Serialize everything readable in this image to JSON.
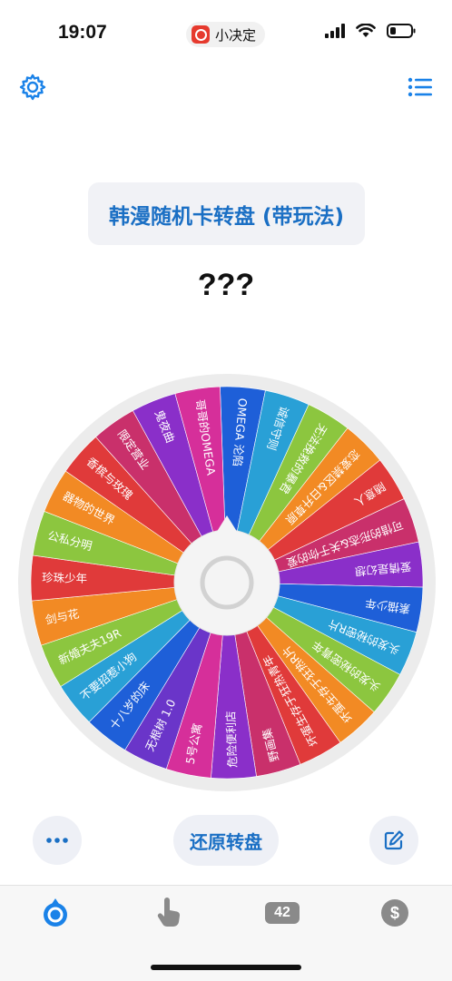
{
  "status": {
    "time": "19:07",
    "app_name": "小决定"
  },
  "header": {
    "settings_icon": "gear-icon",
    "list_icon": "list-icon"
  },
  "wheel": {
    "title": "韩漫随机卡转盘 (带玩法)",
    "result": "???",
    "items": [
      {
        "label": "OMEGA 沦陷",
        "color": "#1e5fd8"
      },
      {
        "label": "诚信守则",
        "color": "#29a0d6"
      },
      {
        "label": "无法挽救的暴君",
        "color": "#8cc63f"
      },
      {
        "label": "恋爱禁区&日升草原",
        "color": "#f28a24"
      },
      {
        "label": "随意人",
        "color": "#e03a3a"
      },
      {
        "label": "可惜的形态&关于你的爱",
        "color": "#c9306b"
      },
      {
        "label": "爱情是幻想",
        "color": "#8a2fc9"
      },
      {
        "label": "素描少年",
        "color": "#1e5fd8"
      },
      {
        "label": "头发的秘密R片",
        "color": "#29a0d6"
      },
      {
        "label": "头发的秘密青年",
        "color": "#8cc63f"
      },
      {
        "label": "坏蛋生存于狂热R片",
        "color": "#f28a24"
      },
      {
        "label": "坏蛋生存于狂热青年",
        "color": "#e03a3a"
      },
      {
        "label": "野画集",
        "color": "#c9306b"
      },
      {
        "label": "危险便利店",
        "color": "#8a2fc9"
      },
      {
        "label": "5号公寓",
        "color": "#d62f9a"
      },
      {
        "label": "无根树 1.0",
        "color": "#6a35c9"
      },
      {
        "label": "十八岁的床",
        "color": "#1e5fd8"
      },
      {
        "label": "不要招惹小狗",
        "color": "#29a0d6"
      },
      {
        "label": "新婚夫夫19R",
        "color": "#8cc63f"
      },
      {
        "label": "剑与花",
        "color": "#f28a24"
      },
      {
        "label": "珍珠少年",
        "color": "#e03a3a"
      },
      {
        "label": "公私分明",
        "color": "#8cc63f"
      },
      {
        "label": "器物的世界",
        "color": "#f28a24"
      },
      {
        "label": "香槟与玫瑰",
        "color": "#e03a3a"
      },
      {
        "label": "限定营业",
        "color": "#c9306b"
      },
      {
        "label": "鬼夜曲",
        "color": "#8a2fc9"
      },
      {
        "label": "哥哥的OMEGA",
        "color": "#d62f9a"
      }
    ]
  },
  "controls": {
    "reset_label": "还原转盘",
    "more_icon": "more-icon",
    "edit_icon": "edit-icon"
  },
  "tabs": {
    "badge_number": "42",
    "dollar_symbol": "$"
  },
  "colors": {
    "accent": "#1a6fc4",
    "tab_active": "#1a82e8",
    "tab_inactive": "#8a8a8a"
  }
}
